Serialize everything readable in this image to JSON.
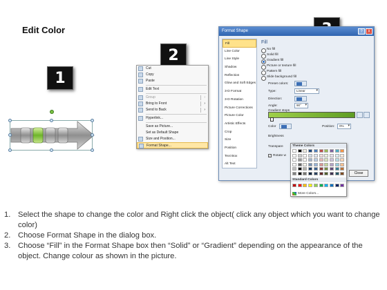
{
  "title": "Edit Color",
  "callouts": [
    "1",
    "2",
    "3"
  ],
  "context_menu": {
    "items": [
      {
        "label": "Cut",
        "underline": "t"
      },
      {
        "label": "Copy"
      },
      {
        "label": "Paste"
      },
      {
        "label": "Edit Text"
      },
      {
        "label": "Group",
        "disabled": true,
        "submenu": true
      },
      {
        "label": "Bring to Front",
        "submenu": true
      },
      {
        "label": "Send to Back",
        "submenu": true
      },
      {
        "label": "Hyperlink..."
      },
      {
        "label": "Save as Picture..."
      },
      {
        "label": "Set as Default Shape"
      },
      {
        "label": "Size and Position..."
      },
      {
        "label": "Format Shape...",
        "highlighted": true
      }
    ]
  },
  "dialog": {
    "title": "Format Shape",
    "help": "?",
    "close": "X",
    "categories": [
      "Fill",
      "Line Color",
      "Line Style",
      "Shadow",
      "Reflection",
      "Glow and Soft Edges",
      "3-D Format",
      "3-D Rotation",
      "Picture Corrections",
      "Picture Color",
      "Artistic Effects",
      "Crop",
      "Size",
      "Position",
      "Text Box",
      "Alt Text"
    ],
    "selected_category": "Fill",
    "fill_heading": "Fill",
    "fill_options": [
      {
        "label": "No fill",
        "checked": false
      },
      {
        "label": "Solid fill",
        "checked": false
      },
      {
        "label": "Gradient fill",
        "checked": true
      },
      {
        "label": "Picture or texture fill",
        "checked": false
      },
      {
        "label": "Pattern fill",
        "checked": false
      },
      {
        "label": "Slide background fill",
        "checked": false
      }
    ],
    "preset_colors_label": "Preset colors:",
    "type_label": "Type:",
    "type_value": "Linear",
    "direction_label": "Direction:",
    "angle_label": "Angle:",
    "angle_value": "90°",
    "gradient_stops_label": "Gradient stops",
    "color_label": "Color",
    "position_label": "Position:",
    "position_value": "0%",
    "brightness_label": "Brightness",
    "transparency_label": "Transpare",
    "rotate_label": "Rotate w",
    "close_button": "Close"
  },
  "color_popup": {
    "theme_heading": "Theme Colors",
    "standard_heading": "Standard Colors",
    "more_colors": "More Colors...",
    "theme_top": [
      "#ffffff",
      "#000000",
      "#eeece1",
      "#1f497d",
      "#4f81bd",
      "#c0504d",
      "#9bbb59",
      "#8064a2",
      "#4bacc6",
      "#f79646"
    ],
    "standard": [
      "#c00000",
      "#ff0000",
      "#ffc000",
      "#ffff00",
      "#92d050",
      "#00b050",
      "#00b0f0",
      "#0070c0",
      "#002060",
      "#7030a0"
    ]
  },
  "steps": [
    {
      "num": "1.",
      "text": "Select the shape to change the color and Right click the object( click any object which you want to change color)"
    },
    {
      "num": "2.",
      "text": "Choose Format Shape in the dialog box."
    },
    {
      "num": "3.",
      "text": "Choose “Fill” in the Format Shape box then “Solid” or “Gradient” depending on the appearance of the object. Change colour as shown in the picture."
    }
  ]
}
